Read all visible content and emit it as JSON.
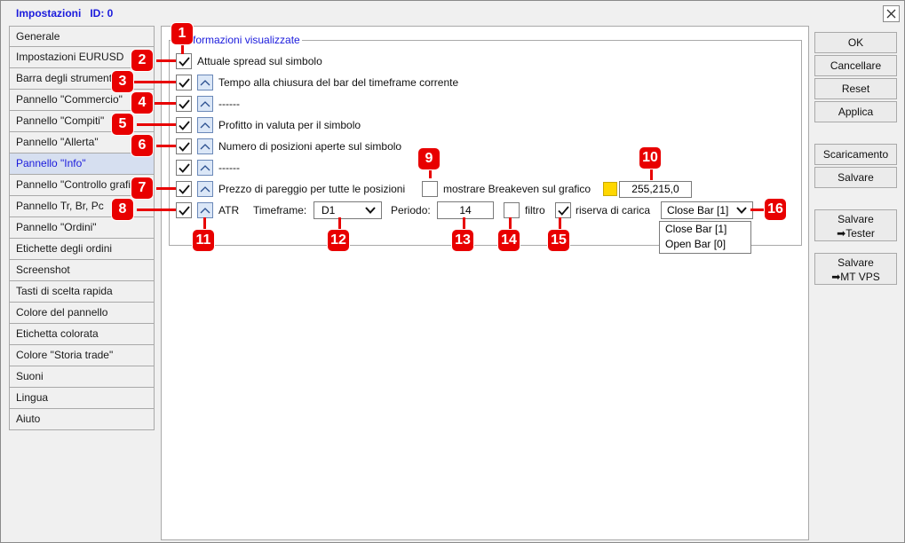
{
  "window": {
    "title": "Impostazioni   ID: 0"
  },
  "sidebar": {
    "items": [
      {
        "label": "Generale"
      },
      {
        "label": "Impostazioni EURUSD"
      },
      {
        "label": "Barra degli strumenti"
      },
      {
        "label": "Pannello \"Commercio\""
      },
      {
        "label": "Pannello \"Compiti\""
      },
      {
        "label": "Pannello \"Allerta\""
      },
      {
        "label": "Pannello \"Info\""
      },
      {
        "label": "Pannello \"Controllo grafico\""
      },
      {
        "label": "Pannello Tr, Br, Pc"
      },
      {
        "label": "Pannello \"Ordini\""
      },
      {
        "label": "Etichette degli ordini"
      },
      {
        "label": "Screenshot"
      },
      {
        "label": "Tasti di scelta rapida"
      },
      {
        "label": "Colore del pannello"
      },
      {
        "label": "Etichetta colorata"
      },
      {
        "label": "Colore \"Storia trade\""
      },
      {
        "label": "Suoni"
      },
      {
        "label": "Lingua"
      },
      {
        "label": "Aiuto"
      }
    ],
    "active_index": 6
  },
  "group": {
    "legend": "Informazioni visualizzate"
  },
  "rows": {
    "spread": "Attuale spread sul simbolo",
    "time_close": "Tempo alla chiusura del bar del timeframe corrente",
    "dashes1": "------",
    "profit": "Profitto in valuta per il simbolo",
    "positions": "Numero di posizioni aperte sul simbolo",
    "dashes2": "------",
    "breakeven_price": "Prezzo di pareggio per tutte le posizioni",
    "breakeven_chart": "mostrare Breakeven sul grafico",
    "color_value": "255,215,0",
    "atr": "ATR",
    "timeframe_label": "Timeframe:",
    "timeframe_value": "D1",
    "period_label": "Periodo:",
    "period_value": "14",
    "filter_label": "filtro",
    "reserve_label": "riserva di carica",
    "bar_value": "Close Bar [1]",
    "bar_options": [
      "Close Bar [1]",
      "Open Bar [0]"
    ]
  },
  "buttons": {
    "ok": "OK",
    "cancel": "Cancellare",
    "reset": "Reset",
    "apply": "Applica",
    "download": "Scaricamento",
    "save": "Salvare",
    "save_tester_1": "Salvare",
    "save_tester_2": "Tester",
    "save_vps_1": "Salvare",
    "save_vps_2": "MT VPS"
  },
  "badges": [
    "1",
    "2",
    "3",
    "4",
    "5",
    "6",
    "7",
    "8",
    "9",
    "10",
    "11",
    "12",
    "13",
    "14",
    "15",
    "16"
  ],
  "colors": {
    "accent": "#1a1adc",
    "badge": "#e80000",
    "swatch": "#ffd700"
  },
  "icons": {
    "check": "check-icon",
    "arrow_up": "arrow-up-icon",
    "chevron": "chevron-down-icon",
    "close": "close-icon",
    "arrow_right": "arrow-right-icon"
  }
}
